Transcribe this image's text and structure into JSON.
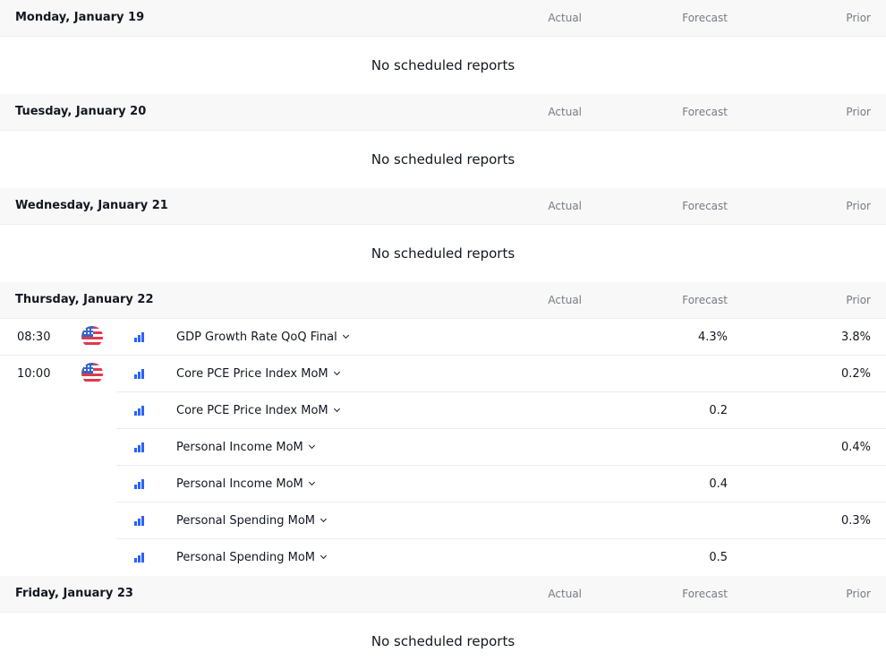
{
  "columns": {
    "actual": "Actual",
    "forecast": "Forecast",
    "prior": "Prior"
  },
  "empty_text": "No scheduled reports",
  "days": [
    {
      "title": "Monday, January 19"
    },
    {
      "title": "Tuesday, January 20"
    },
    {
      "title": "Wednesday, January 21"
    },
    {
      "title": "Thursday, January 22",
      "events": [
        {
          "time": "08:30",
          "country": "US",
          "name": "GDP Growth Rate QoQ Final",
          "actual": "",
          "forecast": "4.3%",
          "prior": "3.8%"
        },
        {
          "time": "10:00",
          "country": "US",
          "name": "Core PCE Price Index MoM",
          "actual": "",
          "forecast": "",
          "prior": "0.2%"
        },
        {
          "name": "Core PCE Price Index MoM",
          "actual": "",
          "forecast": "0.2",
          "prior": ""
        },
        {
          "name": "Personal Income MoM",
          "actual": "",
          "forecast": "",
          "prior": "0.4%"
        },
        {
          "name": "Personal Income MoM",
          "actual": "",
          "forecast": "0.4",
          "prior": ""
        },
        {
          "name": "Personal Spending MoM",
          "actual": "",
          "forecast": "",
          "prior": "0.3%"
        },
        {
          "name": "Personal Spending MoM",
          "actual": "",
          "forecast": "0.5",
          "prior": ""
        }
      ]
    },
    {
      "title": "Friday, January 23"
    }
  ],
  "colors": {
    "header_bg": "#f8f8f8",
    "importance_icon": "#2962ff",
    "muted_text": "#787b86"
  },
  "icons": {
    "flag": "us-flag-icon",
    "importance": "importance-bars-icon",
    "expand": "chevron-down-icon"
  }
}
